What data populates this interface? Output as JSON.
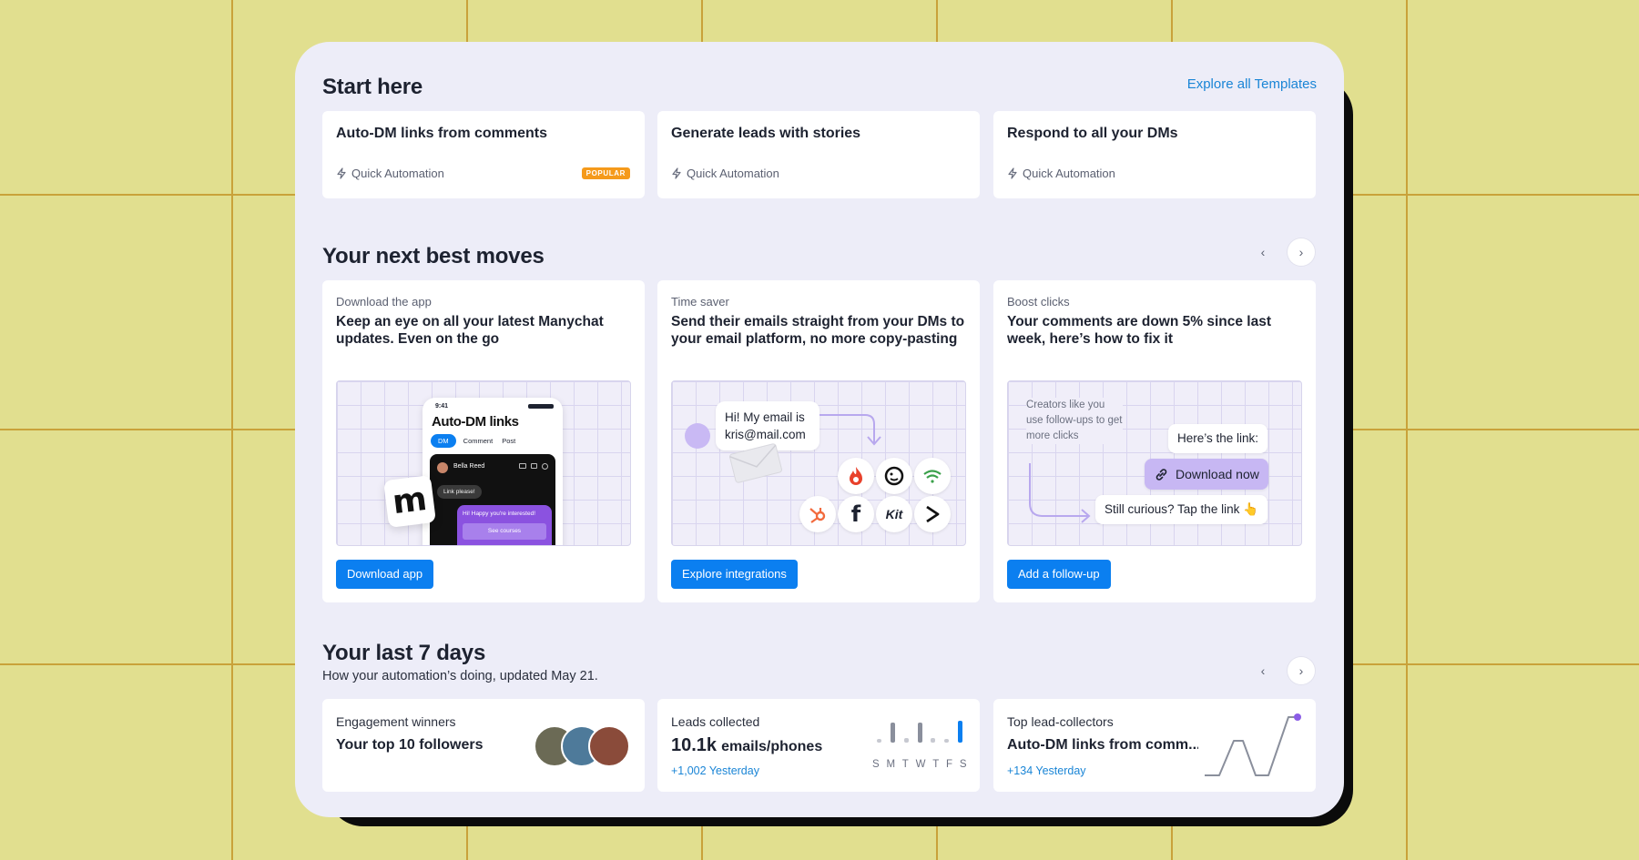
{
  "start_here": {
    "title": "Start here",
    "explore_link": "Explore all Templates",
    "cards": [
      {
        "title": "Auto-DM links from comments",
        "meta": "Quick Automation",
        "badge": "POPULAR"
      },
      {
        "title": "Generate leads with stories",
        "meta": "Quick Automation"
      },
      {
        "title": "Respond to all your DMs",
        "meta": "Quick Automation"
      }
    ]
  },
  "next_moves": {
    "title": "Your next best moves",
    "prev": "‹",
    "next": "›",
    "cards": [
      {
        "eyebrow": "Download the app",
        "text": "Keep an eye on all your latest Manychat updates. Even on the go",
        "button": "Download app",
        "phone": {
          "time": "9:41",
          "title": "Auto-DM links",
          "tabs": [
            "DM",
            "Comment",
            "Post"
          ],
          "contact": "Bella Reed",
          "msg_in": "Link please!",
          "msg_out": "Hi! Happy you're interested!",
          "msg_button": "See courses"
        },
        "logo_glyph": "m"
      },
      {
        "eyebrow": "Time saver",
        "text": "Send their emails straight from your DMs to your email platform, no more copy-pasting",
        "button": "Explore integrations",
        "bubble_line1": "Hi! My email is",
        "bubble_line2": "kris@mail.com",
        "logos": [
          "fire-icon",
          "mailchimp-icon",
          "wifi-icon",
          "hubspot-icon",
          "facebook-icon",
          "kit-icon",
          "activecampaign-icon"
        ],
        "logo_text_kit": "Kit",
        "logo_text_f": "f"
      },
      {
        "eyebrow": "Boost clicks",
        "text": "Your comments are down 5% since last week, here’s how to fix it",
        "button": "Add a follow-up",
        "note": "Creators like you use follow-ups to get more clicks",
        "chip1": "Here’s the link:",
        "chip2": "Download now",
        "chip3": "Still curious? Tap the link 👆"
      }
    ]
  },
  "last7": {
    "title": "Your last 7 days",
    "subtitle": "How your automation’s doing, updated May 21.",
    "prev": "‹",
    "next": "›",
    "cards": [
      {
        "label": "Engagement winners",
        "main": "Your top 10 followers"
      },
      {
        "label": "Leads collected",
        "value": "10.1k",
        "unit": "emails/phones",
        "delta": "+1,002 Yesterday",
        "days": [
          "S",
          "M",
          "T",
          "W",
          "T",
          "F",
          "S"
        ],
        "bar_levels": [
          0.15,
          0.9,
          0.2,
          0.9,
          0.2,
          0.15,
          1.0
        ]
      },
      {
        "label": "Top lead-collectors",
        "main": "Auto-DM links from comm...",
        "delta": "+134 Yesterday"
      }
    ]
  },
  "colors": {
    "accent": "#0b7ff0",
    "popular": "#f59a1b",
    "purple": "#9b83ea",
    "panel": "#ededf8",
    "background": "#e1df8f"
  }
}
